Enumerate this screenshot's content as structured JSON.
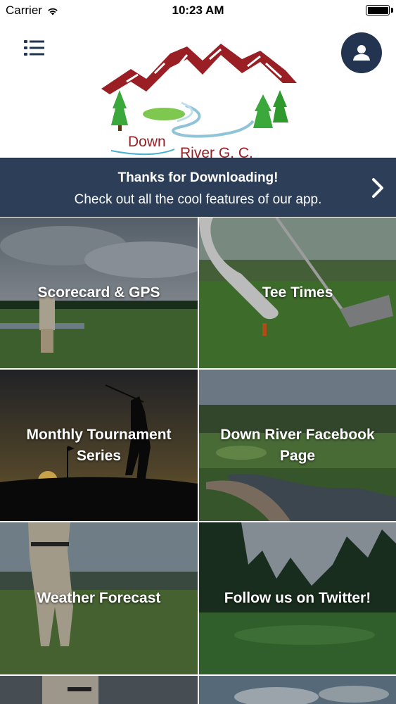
{
  "status_bar": {
    "carrier": "Carrier",
    "time": "10:23 AM"
  },
  "header": {
    "logo_line1": "Down",
    "logo_line2": "River G. C.",
    "menu_icon": "list-menu-icon",
    "profile_icon": "user-avatar-icon"
  },
  "promo": {
    "title": "Thanks for Downloading!",
    "subtitle": "Check out all the cool features of our app.",
    "icon": "chevron-right-icon"
  },
  "tiles": [
    {
      "label": "Scorecard & GPS"
    },
    {
      "label": "Tee Times"
    },
    {
      "label": "Monthly Tournament Series"
    },
    {
      "label": "Down River Facebook Page"
    },
    {
      "label": "Weather Forecast"
    },
    {
      "label": "Follow us on Twitter!"
    }
  ],
  "colors": {
    "navy": "#223450",
    "banner": "#2c3e58",
    "logo_red": "#9a1f24",
    "logo_green": "#2e9a2e"
  }
}
